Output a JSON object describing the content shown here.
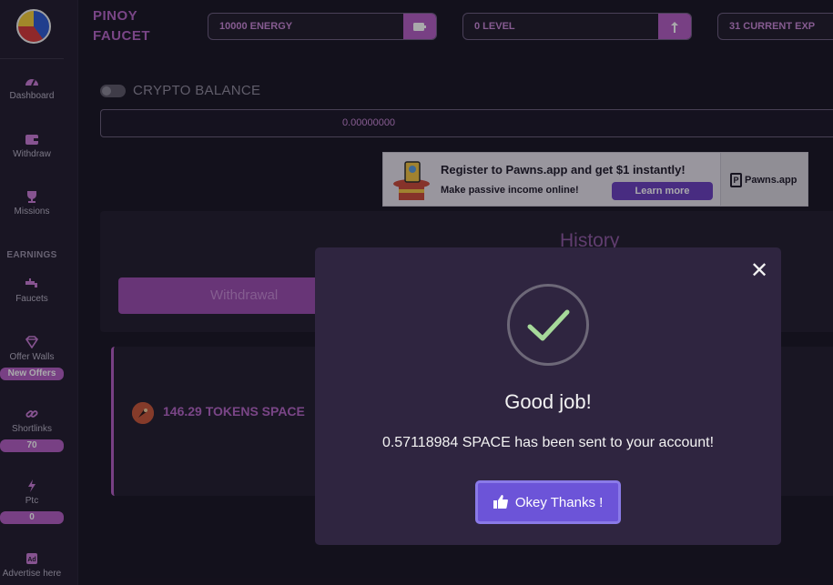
{
  "brand": {
    "line1": "PINOY",
    "line2": "FAUCET"
  },
  "header": {
    "energy": {
      "label": "10000 ENERGY",
      "icon": "battery-icon"
    },
    "level": {
      "label": "0 LEVEL",
      "icon": "level-up-icon"
    },
    "exp": {
      "label": "31 CURRENT EXP"
    }
  },
  "sidebar": {
    "items": [
      {
        "label": "Dashboard",
        "icon": "dashboard-icon"
      },
      {
        "label": "Withdraw",
        "icon": "wallet-icon"
      },
      {
        "label": "Missions",
        "icon": "trophy-icon"
      }
    ],
    "section_earnings": "EARNINGS",
    "earnings": [
      {
        "label": "Faucets",
        "icon": "faucet-icon"
      },
      {
        "label": "Offer Walls",
        "icon": "gem-icon",
        "badge": "New Offers"
      },
      {
        "label": "Shortlinks",
        "icon": "link-icon",
        "badge": "70"
      },
      {
        "label": "Ptc",
        "icon": "bolt-icon",
        "badge": "0"
      },
      {
        "label": "Advertise here",
        "icon": "ad-icon"
      }
    ]
  },
  "crypto": {
    "label": "CRYPTO BALANCE",
    "balance": "0.00000000",
    "toggle_on": false
  },
  "ad": {
    "title": "Register to Pawns.app and get $1 instantly!",
    "subtitle": "Make passive income online!",
    "button": "Learn more",
    "brand": "Pawns.app"
  },
  "history": {
    "title": "History",
    "tab_withdrawal": "Withdrawal",
    "entry": "146.29 TOKENS SPACE"
  },
  "modal": {
    "title": "Good job!",
    "message": "0.57118984 SPACE has been sent to your account!",
    "button": "Okey Thanks !",
    "close": "✕"
  },
  "colors": {
    "accent": "#b45fc4",
    "modal_bg": "#2f2540",
    "button": "#6c54d8",
    "check": "#a6d99a"
  }
}
